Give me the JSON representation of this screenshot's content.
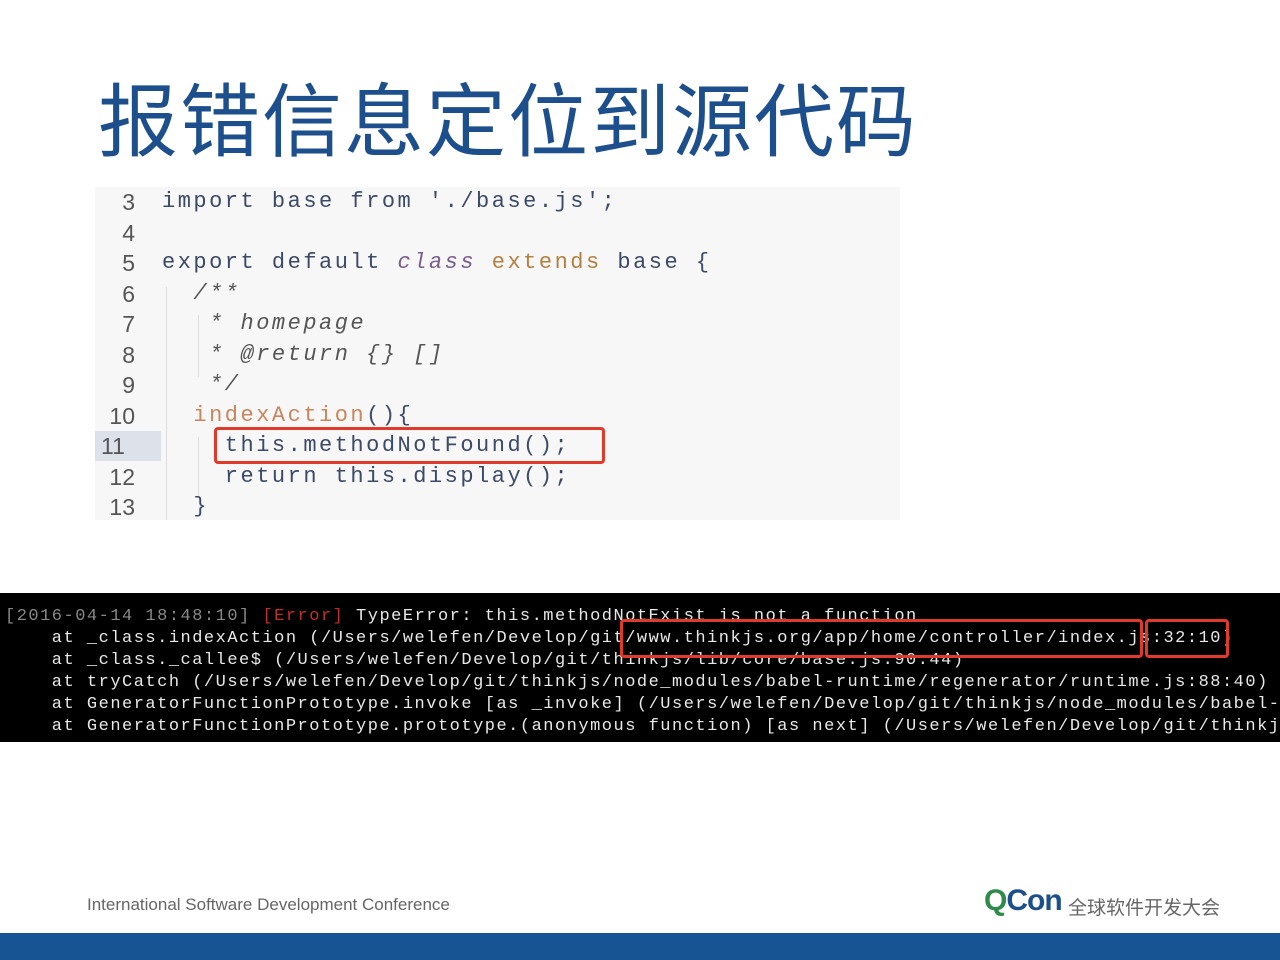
{
  "slide": {
    "title": "报错信息定位到源代码",
    "footer_text": "International Software Development Conference",
    "logo": {
      "brand": "QCon",
      "subtitle": "全球软件开发大会"
    },
    "colors": {
      "title": "#1d4f8c",
      "highlight_box": "#e03a2a",
      "bottom_bar": "#175493",
      "terminal_bg": "#000000"
    }
  },
  "code": {
    "highlighted_line": "11",
    "lines": [
      {
        "n": "3",
        "tokens": [
          [
            "import base from './base.js';",
            "kw"
          ]
        ]
      },
      {
        "n": "4",
        "tokens": []
      },
      {
        "n": "5",
        "tokens": [
          [
            "export default ",
            "kw"
          ],
          [
            "class",
            "cls"
          ],
          [
            " extends",
            "ext"
          ],
          [
            " base {",
            "kw"
          ]
        ]
      },
      {
        "n": "6",
        "tokens": [
          [
            "  /**",
            "cm"
          ]
        ]
      },
      {
        "n": "7",
        "tokens": [
          [
            "   * homepage",
            "cm"
          ]
        ]
      },
      {
        "n": "8",
        "tokens": [
          [
            "   * @return {} []",
            "cm"
          ]
        ]
      },
      {
        "n": "9",
        "tokens": [
          [
            "   */",
            "cm"
          ]
        ]
      },
      {
        "n": "10",
        "tokens": [
          [
            "  indexAction",
            "fn"
          ],
          [
            "(){",
            "pl"
          ]
        ]
      },
      {
        "n": "11",
        "tokens": [
          [
            "    this.methodNotFound();",
            "pl"
          ]
        ]
      },
      {
        "n": "12",
        "tokens": [
          [
            "    return this.display();",
            "pl"
          ]
        ]
      },
      {
        "n": "13",
        "tokens": [
          [
            "  }",
            "pl"
          ]
        ]
      }
    ]
  },
  "terminal": {
    "lines": [
      [
        [
          "[2016-04-14 18:48:10] ",
          "ts"
        ],
        [
          "[Error]",
          "err"
        ],
        [
          " TypeError: this.methodNotExist is not a function",
          ""
        ]
      ],
      [
        [
          "    at _class.indexAction (/Users/welefen/Develop/git/www.thinkjs.org/app/home/controller/index.js:32:10)",
          ""
        ]
      ],
      [
        [
          "    at _class._callee$ (/Users/welefen/Develop/git/thinkjs/lib/core/base.js:90:44)",
          ""
        ]
      ],
      [
        [
          "    at tryCatch (/Users/welefen/Develop/git/thinkjs/node_modules/babel-runtime/regenerator/runtime.js:88:40)",
          ""
        ]
      ],
      [
        [
          "    at GeneratorFunctionPrototype.invoke [as _invoke] (/Users/welefen/Develop/git/thinkjs/node_modules/babel-runtime",
          ""
        ]
      ],
      [
        [
          "    at GeneratorFunctionPrototype.prototype.(anonymous function) [as next] (/Users/welefen/Develop/git/thinkjs",
          ""
        ]
      ]
    ]
  }
}
